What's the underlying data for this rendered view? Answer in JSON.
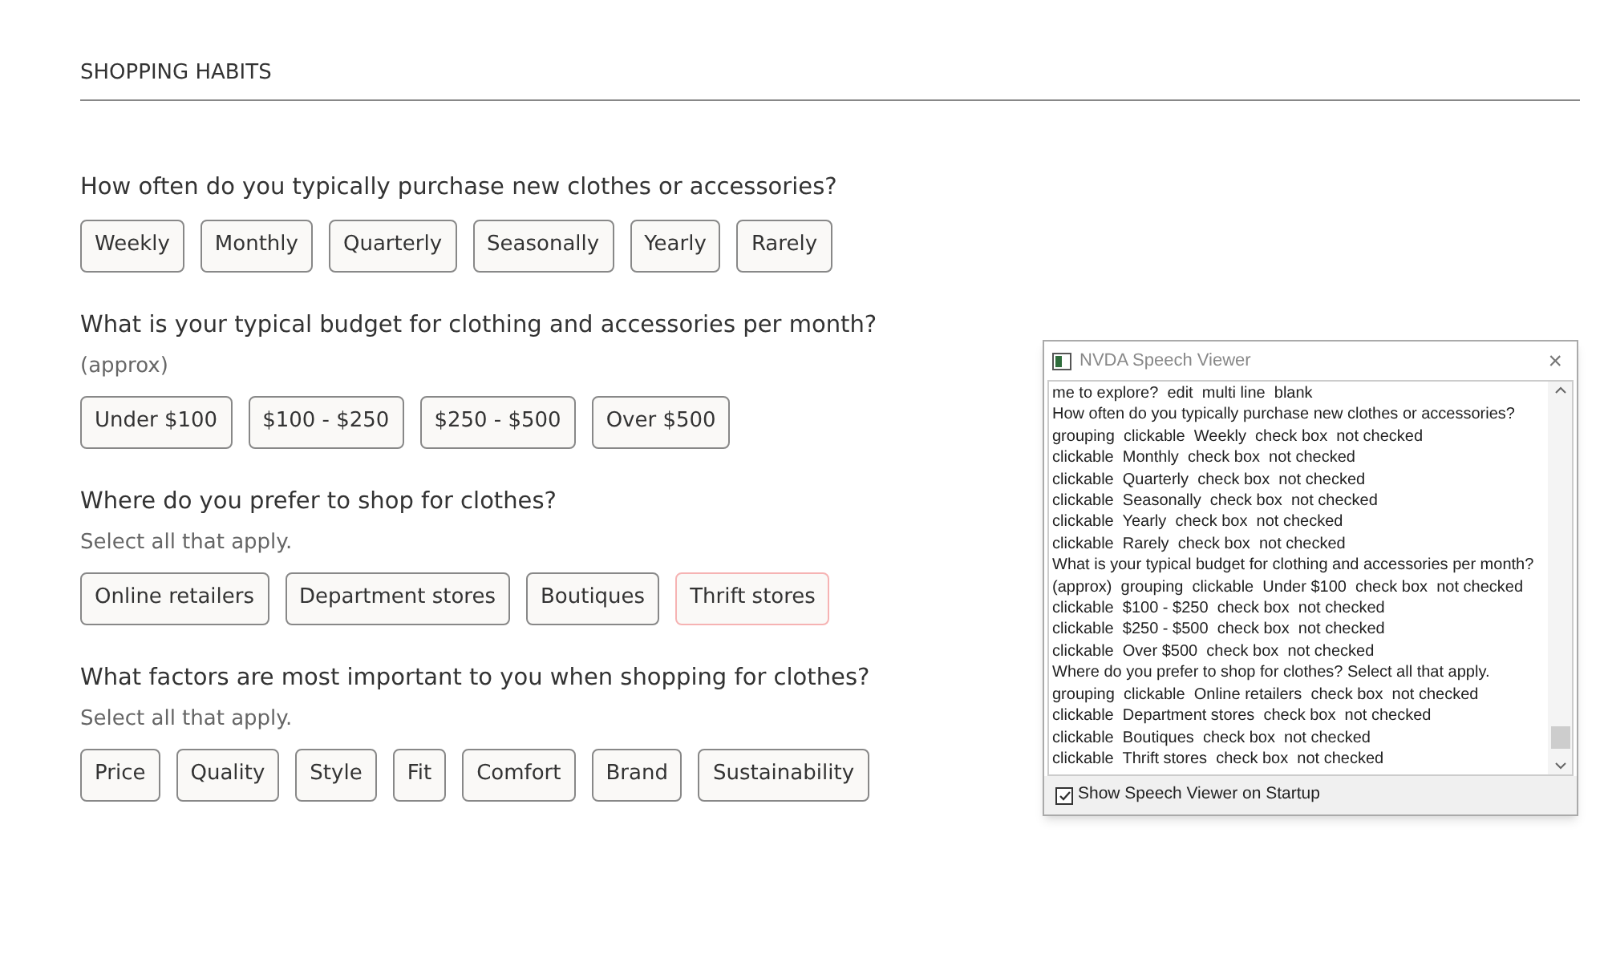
{
  "section_title": "SHOPPING HABITS",
  "questions": [
    {
      "question": "How often do you typically purchase new clothes or accessories?",
      "options": [
        {
          "label": "Weekly",
          "focused": false
        },
        {
          "label": "Monthly",
          "focused": false
        },
        {
          "label": "Quarterly",
          "focused": false
        },
        {
          "label": "Seasonally",
          "focused": false
        },
        {
          "label": "Yearly",
          "focused": false
        },
        {
          "label": "Rarely",
          "focused": false
        }
      ]
    },
    {
      "question": "What is your typical budget for clothing and accessories per month?",
      "hint": "(approx)",
      "options": [
        {
          "label": "Under $100",
          "focused": false
        },
        {
          "label": "$100 - $250",
          "focused": false
        },
        {
          "label": "$250 - $500",
          "focused": false
        },
        {
          "label": "Over $500",
          "focused": false
        }
      ]
    },
    {
      "question": "Where do you prefer to shop for clothes?",
      "hint": "Select all that apply.",
      "options": [
        {
          "label": "Online retailers",
          "focused": false
        },
        {
          "label": "Department stores",
          "focused": false
        },
        {
          "label": "Boutiques",
          "focused": false
        },
        {
          "label": "Thrift stores",
          "focused": true
        }
      ]
    },
    {
      "question": "What factors are most important to you when shopping for clothes?",
      "hint": "Select all that apply.",
      "options": [
        {
          "label": "Price",
          "focused": false
        },
        {
          "label": "Quality",
          "focused": false
        },
        {
          "label": "Style",
          "focused": false
        },
        {
          "label": "Fit",
          "focused": false
        },
        {
          "label": "Comfort",
          "focused": false
        },
        {
          "label": "Brand",
          "focused": false
        },
        {
          "label": "Sustainability",
          "focused": false
        }
      ]
    }
  ],
  "speech_viewer": {
    "title": "NVDA Speech Viewer",
    "close": "×",
    "lines": [
      "me to explore?  edit  multi line  blank",
      "How often do you typically purchase new clothes or accessories?",
      "grouping  clickable  Weekly  check box  not checked",
      "clickable  Monthly  check box  not checked",
      "clickable  Quarterly  check box  not checked",
      "clickable  Seasonally  check box  not checked",
      "clickable  Yearly  check box  not checked",
      "clickable  Rarely  check box  not checked",
      "What is your typical budget for clothing and accessories per month?",
      "(approx)  grouping  clickable  Under $100  check box  not checked",
      "clickable  $100 - $250  check box  not checked",
      "clickable  $250 - $500  check box  not checked",
      "clickable  Over $500  check box  not checked",
      "Where do you prefer to shop for clothes? Select all that apply.",
      "grouping  clickable  Online retailers  check box  not checked",
      "clickable  Department stores  check box  not checked",
      "clickable  Boutiques  check box  not checked",
      "clickable  Thrift stores  check box  not checked"
    ],
    "startup_checkbox": {
      "label": "Show Speech Viewer on Startup",
      "checked": true
    }
  }
}
